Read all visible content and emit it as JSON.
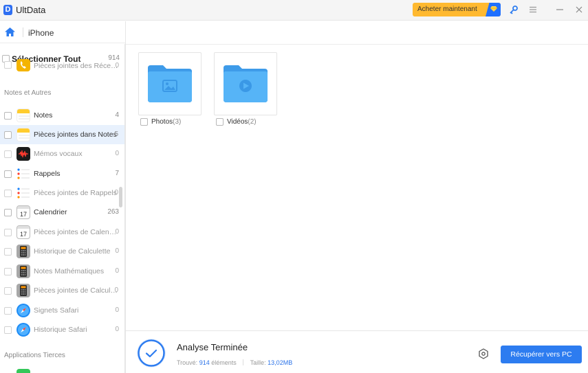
{
  "app": {
    "title": "UltData",
    "logo_letter": "D",
    "buy_label": "Acheter maintenant",
    "colors": {
      "accent": "#2d7cf0",
      "buy": "#ffb930",
      "selected_row": "#e8f1fd"
    }
  },
  "nav": {
    "device": "iPhone"
  },
  "sidebar": {
    "select_all": {
      "label": "Sélectionner Tout",
      "count": "914"
    },
    "top_item": {
      "label": "Pièces jointes des Réce…",
      "count": "0",
      "icon": "phone-app-icon"
    },
    "sections": [
      {
        "title": "Notes et Autres"
      },
      {
        "title": "Applications Tierces"
      }
    ],
    "items": [
      {
        "label": "Notes",
        "count": "4",
        "icon": "notes-app-icon"
      },
      {
        "label": "Pièces jointes dans Notes",
        "count": "5",
        "icon": "notes-app-icon"
      },
      {
        "label": "Mémos vocaux",
        "count": "0",
        "icon": "voice-memos-app-icon"
      },
      {
        "label": "Rappels",
        "count": "7",
        "icon": "reminders-app-icon"
      },
      {
        "label": "Pièces jointes de Rappels",
        "count": "0",
        "icon": "reminders-app-icon"
      },
      {
        "label": "Calendrier",
        "count": "263",
        "icon": "calendar-app-icon",
        "day": "17"
      },
      {
        "label": "Pièces jointes de Calen…",
        "count": "0",
        "icon": "calendar-app-icon",
        "day": "17"
      },
      {
        "label": "Historique de Calculette",
        "count": "0",
        "icon": "calculator-app-icon"
      },
      {
        "label": "Notes Mathématiques",
        "count": "0",
        "icon": "calculator-app-icon"
      },
      {
        "label": "Pièces jointes de Calcul…",
        "count": "0",
        "icon": "calculator-app-icon"
      },
      {
        "label": "Signets Safari",
        "count": "0",
        "icon": "safari-app-icon"
      },
      {
        "label": "Historique Safari",
        "count": "0",
        "icon": "safari-app-icon"
      }
    ]
  },
  "main": {
    "folders": [
      {
        "label": "Photos",
        "count": "(3)",
        "icon": "photo-folder-icon"
      },
      {
        "label": "Vidéos",
        "count": "(2)",
        "icon": "video-folder-icon"
      }
    ]
  },
  "status": {
    "title": "Analyse Terminée",
    "found_label": "Trouvé:",
    "found_count": "914",
    "found_unit": "éléments",
    "size_label": "Taille:",
    "size_value": "13,02MB",
    "recover_label": "Récupérer vers PC"
  }
}
